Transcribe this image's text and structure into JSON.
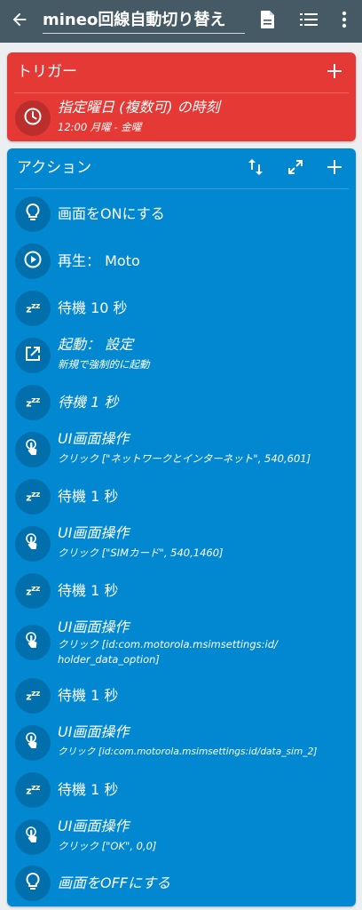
{
  "appbar": {
    "title": "mineo回線自動切り替え",
    "back_icon": "arrow-left-icon",
    "icons": [
      "document-icon",
      "list-icon",
      "more-vert-icon"
    ]
  },
  "colors": {
    "appbar": "#455a64",
    "trigger": "#e53935",
    "action": "#0288d1",
    "background": "#eceff1"
  },
  "trigger": {
    "header": "トリガー",
    "item": {
      "icon": "clock-icon",
      "title": "指定曜日 (複数可) の時刻",
      "detail": "12:00 月曜 - 金曜"
    }
  },
  "action": {
    "header": "アクション",
    "header_icons": [
      "reorder-icon",
      "expand-icon",
      "add-icon"
    ],
    "items": [
      {
        "icon": "lightbulb-icon",
        "title": "画面をONにする",
        "detail": ""
      },
      {
        "icon": "play-circle-icon",
        "title": "再生： Moto",
        "detail": ""
      },
      {
        "icon": "zzz-icon",
        "title": "待機 10 秒",
        "detail": ""
      },
      {
        "icon": "launch-icon",
        "title": "起動： 設定",
        "detail": "新規で強制的に起動"
      },
      {
        "icon": "zzz-icon",
        "title": "待機 1 秒",
        "detail": ""
      },
      {
        "icon": "touch-icon",
        "title": "UI画面操作",
        "detail": "クリック [\"ネットワークとインターネット\", 540,601]"
      },
      {
        "icon": "zzz-icon",
        "title": "待機 1 秒",
        "detail": ""
      },
      {
        "icon": "touch-icon",
        "title": "UI画面操作",
        "detail": "クリック [\"SIMカード\", 540,1460]"
      },
      {
        "icon": "zzz-icon",
        "title": "待機 1 秒",
        "detail": ""
      },
      {
        "icon": "touch-icon",
        "title": "UI画面操作",
        "detail": "クリック [id:com.motorola.msimsettings:id/",
        "detail2": "holder_data_option]"
      },
      {
        "icon": "zzz-icon",
        "title": "待機 1 秒",
        "detail": ""
      },
      {
        "icon": "touch-icon",
        "title": "UI画面操作",
        "detail": "クリック [id:com.motorola.msimsettings:id/data_sim_2]"
      },
      {
        "icon": "zzz-icon",
        "title": "待機 1 秒",
        "detail": ""
      },
      {
        "icon": "touch-icon",
        "title": "UI画面操作",
        "detail": "クリック [\"OK\", 0,0]"
      },
      {
        "icon": "lightbulb-icon",
        "title": "画面をOFFにする",
        "detail": ""
      }
    ]
  }
}
